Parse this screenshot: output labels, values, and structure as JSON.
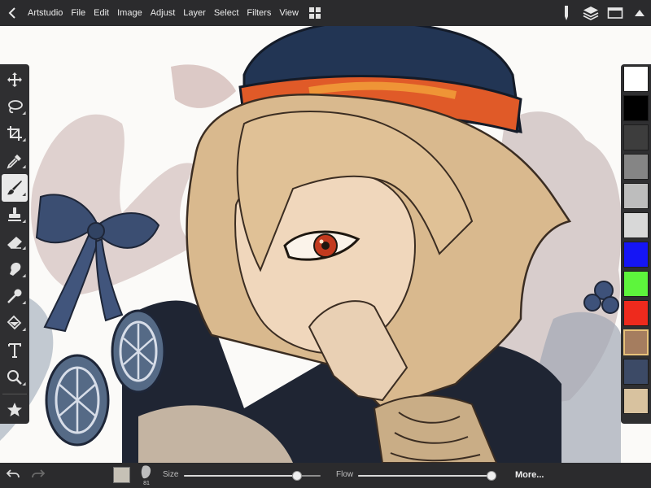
{
  "app": {
    "name": "Artstudio",
    "menu": [
      "File",
      "Edit",
      "Image",
      "Adjust",
      "Layer",
      "Select",
      "Filters",
      "View"
    ]
  },
  "icons": {
    "back": "chevron-left-icon",
    "grid": "grid-icon",
    "pencil": "pencil-icon",
    "layers": "layers-icon",
    "window": "window-icon",
    "collapse": "triangle-up-icon"
  },
  "tools": [
    {
      "id": "move",
      "icon": "move-arrows-icon",
      "sub": false
    },
    {
      "id": "lasso",
      "icon": "lasso-icon",
      "sub": true
    },
    {
      "id": "crop",
      "icon": "crop-icon",
      "sub": true
    },
    {
      "id": "eyedropper",
      "icon": "eyedropper-icon",
      "sub": true
    },
    {
      "id": "brush",
      "icon": "brush-icon",
      "sub": true,
      "active": true
    },
    {
      "id": "stamp",
      "icon": "stamp-icon",
      "sub": true
    },
    {
      "id": "eraser",
      "icon": "eraser-icon",
      "sub": true
    },
    {
      "id": "smudge",
      "icon": "smudge-icon",
      "sub": true
    },
    {
      "id": "dodge",
      "icon": "dodge-burn-icon",
      "sub": true
    },
    {
      "id": "fill",
      "icon": "paint-bucket-icon",
      "sub": true
    },
    {
      "id": "text",
      "icon": "text-icon",
      "sub": false
    },
    {
      "id": "zoom",
      "icon": "zoom-icon",
      "sub": true
    },
    {
      "id": "favorite",
      "icon": "star-icon",
      "sub": false
    }
  ],
  "palette": {
    "colors": [
      "#ffffff",
      "#000000",
      "#3d3d3d",
      "#858585",
      "#bdbdbd",
      "#d8d8d8",
      "#1515f5",
      "#5df53c",
      "#ee2a1d",
      "#a57d5f",
      "#3c4a66",
      "#d8c29f"
    ],
    "selected_index": 9
  },
  "bottom": {
    "current_color": "#c6c1b6",
    "brush_size_value": "81",
    "size_label": "Size",
    "size_slider": 0.83,
    "flow_label": "Flow",
    "flow_slider": 0.99,
    "more_label": "More..."
  },
  "colors": {
    "bar_bg": "#2b2b2d",
    "panel_bg": "#2f2f31",
    "active_tool_bg": "#e9e9e9"
  }
}
